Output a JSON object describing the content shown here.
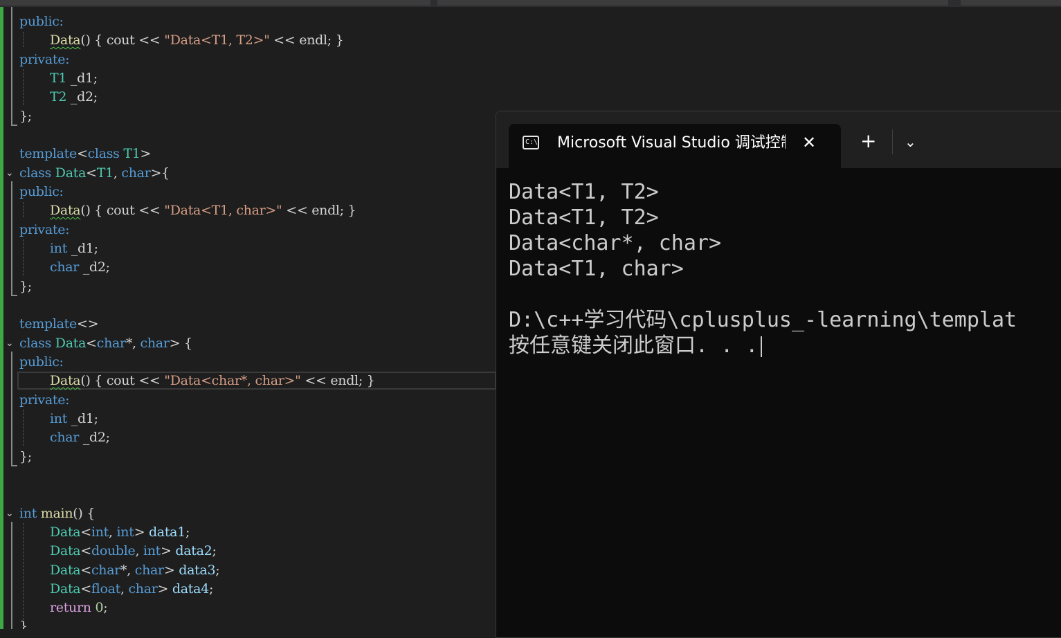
{
  "editor": {
    "lines": {
      "l1": "public:",
      "l2_fn": "Data",
      "l2_rest": "() { cout << ",
      "l2_str": "\"Data<T1, T2>\"",
      "l2_end": " << endl; }",
      "l3": "private:",
      "l4_ty": "T1",
      "l4_rest": " _d1;",
      "l5_ty": "T2",
      "l5_rest": " _d2;",
      "l6": "};",
      "l7_kw": "template",
      "l7_a": "<",
      "l7_kw2": "class",
      "l7_ty": " T1",
      "l7_b": ">",
      "l8_kw": "class",
      "l8_ty": " Data",
      "l8_a": "<",
      "l8_ty2": "T1",
      "l8_b": ", ",
      "l8_kw2": "char",
      "l8_c": ">{",
      "l9": "public:",
      "l10_fn": "Data",
      "l10_rest": "() { cout << ",
      "l10_str": "\"Data<T1, char>\"",
      "l10_end": " << endl; }",
      "l11": "private:",
      "l12_kw": "int",
      "l12_rest": " _d1;",
      "l13_kw": "char",
      "l13_rest": " _d2;",
      "l14": "};",
      "l15_kw": "template",
      "l15_rest": "<>",
      "l16_kw": "class",
      "l16_ty": " Data",
      "l16_a": "<",
      "l16_kw2": "char",
      "l16_b": "*, ",
      "l16_kw3": "char",
      "l16_c": "> {",
      "l17": "public:",
      "l18_fn": "Data",
      "l18_rest": "() { cout << ",
      "l18_str": "\"Data<char*, char>\"",
      "l18_end": " << endl; }",
      "l19": "private:",
      "l20_kw": "int",
      "l20_rest": " _d1;",
      "l21_kw": "char",
      "l21_rest": " _d2;",
      "l22": "};",
      "l23_kw": "int",
      "l23_fn": " main",
      "l23_rest": "() {",
      "l24_ty": "Data",
      "l24_a": "<",
      "l24_kw": "int",
      "l24_b": ", ",
      "l24_kw2": "int",
      "l24_c": "> ",
      "l24_id": "data1",
      "l24_d": ";",
      "l25_ty": "Data",
      "l25_a": "<",
      "l25_kw": "double",
      "l25_b": ", ",
      "l25_kw2": "int",
      "l25_c": "> ",
      "l25_id": "data2",
      "l25_d": ";",
      "l26_ty": "Data",
      "l26_a": "<",
      "l26_kw": "char",
      "l26_b": "*, ",
      "l26_kw2": "char",
      "l26_c": "> ",
      "l26_id": "data3",
      "l26_d": ";",
      "l27_ty": "Data",
      "l27_a": "<",
      "l27_kw": "float",
      "l27_b": ", ",
      "l27_kw2": "char",
      "l27_c": "> ",
      "l27_id": "data4",
      "l27_d": ";",
      "l28_kw": "return",
      "l28_num": " 0",
      "l28_rest": ";",
      "l29": "}"
    }
  },
  "terminal": {
    "tab_title": "Microsoft Visual Studio 调试控制台",
    "tab_icon_glyph": "C:\\",
    "close_glyph": "✕",
    "new_tab_glyph": "+",
    "dropdown_glyph": "⌄",
    "output": [
      "Data<T1, T2>",
      "Data<T1, T2>",
      "Data<char*, char>",
      "Data<T1, char>",
      "",
      "D:\\c++学习代码\\cplusplus_-learning\\templat",
      "按任意键关闭此窗口. . ."
    ]
  },
  "colors": {
    "editor_bg": "#1e1e1e",
    "keyword": "#569cd6",
    "type": "#4ec9b0",
    "function": "#dcdcaa",
    "string": "#d69d85",
    "change_bar": "#3ea845",
    "terminal_bg": "#0c0c0c"
  }
}
